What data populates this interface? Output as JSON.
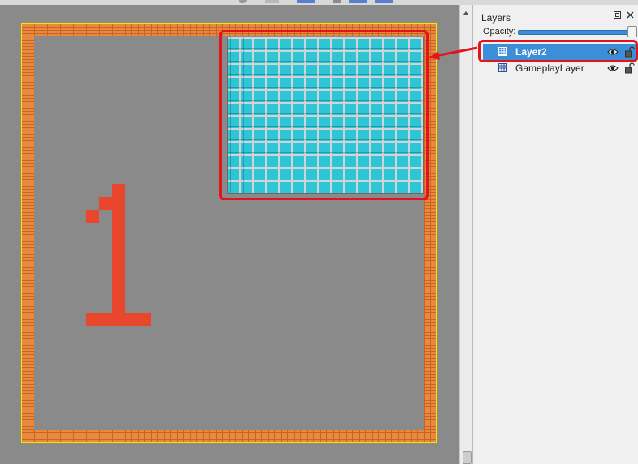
{
  "layers_panel": {
    "title": "Layers",
    "opacity_label": "Opacity:",
    "opacity_value": 1.0,
    "float_icon": "float-window-icon",
    "close_icon": "close-icon",
    "layers": [
      {
        "name": "Layer2",
        "selected": true,
        "visible": true,
        "locked": false,
        "type_icon": "tile-layer-icon"
      },
      {
        "name": "GameplayLayer",
        "selected": false,
        "visible": true,
        "locked": false,
        "type_icon": "tile-layer-icon"
      }
    ]
  },
  "colors": {
    "annotation_red": "#e2141c",
    "selection_blue": "#3d8ed8",
    "canvas_bg": "#8a8a8a",
    "brick_orange": "#e88a3a",
    "digit_red": "#e8472e",
    "tile_cyan": "#2ec6d4"
  }
}
